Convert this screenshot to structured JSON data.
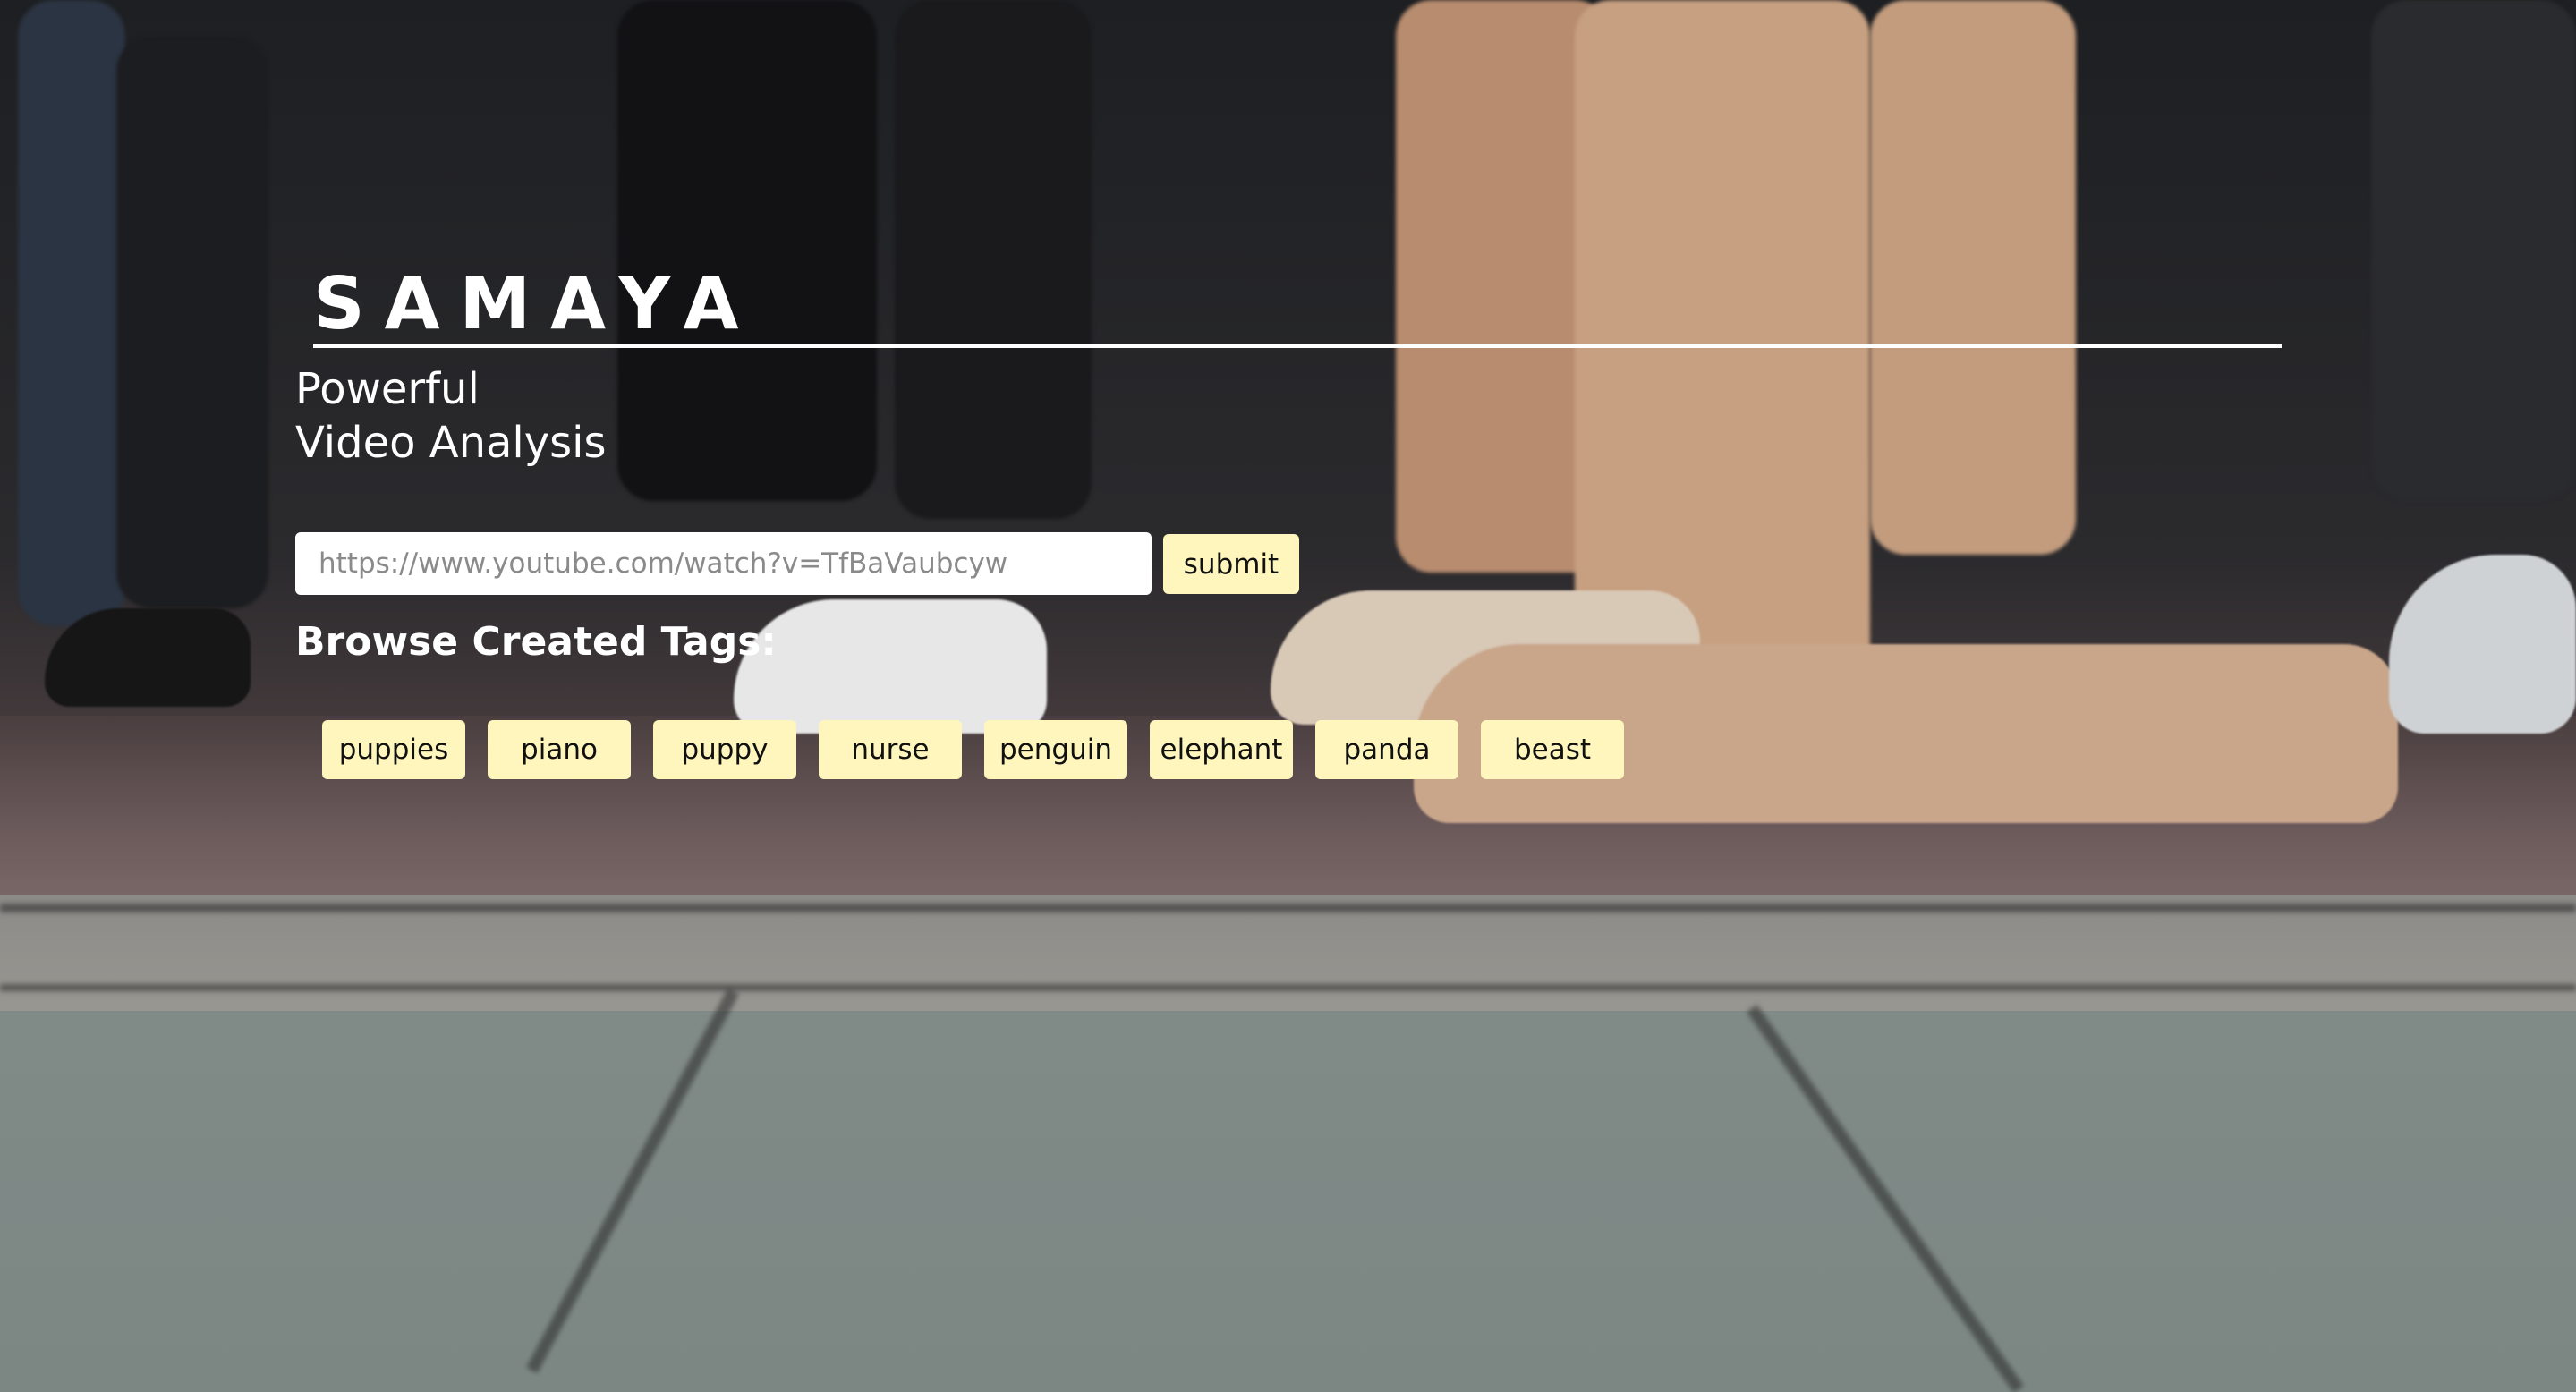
{
  "header": {
    "brand": "SAMAYA",
    "tagline_line1": "Powerful",
    "tagline_line2": "Video Analysis"
  },
  "search": {
    "placeholder": "https://www.youtube.com/watch?v=TfBaVaubcyw",
    "value": "",
    "submit_label": "submit"
  },
  "tags": {
    "heading": "Browse Created Tags:",
    "items": [
      "puppies",
      "piano",
      "puppy",
      "nurse",
      "penguin",
      "elephant",
      "panda",
      "beast"
    ]
  },
  "colors": {
    "tag_background": "#fff6bd",
    "input_background": "#ffffff",
    "heading_text": "#ffffff"
  }
}
